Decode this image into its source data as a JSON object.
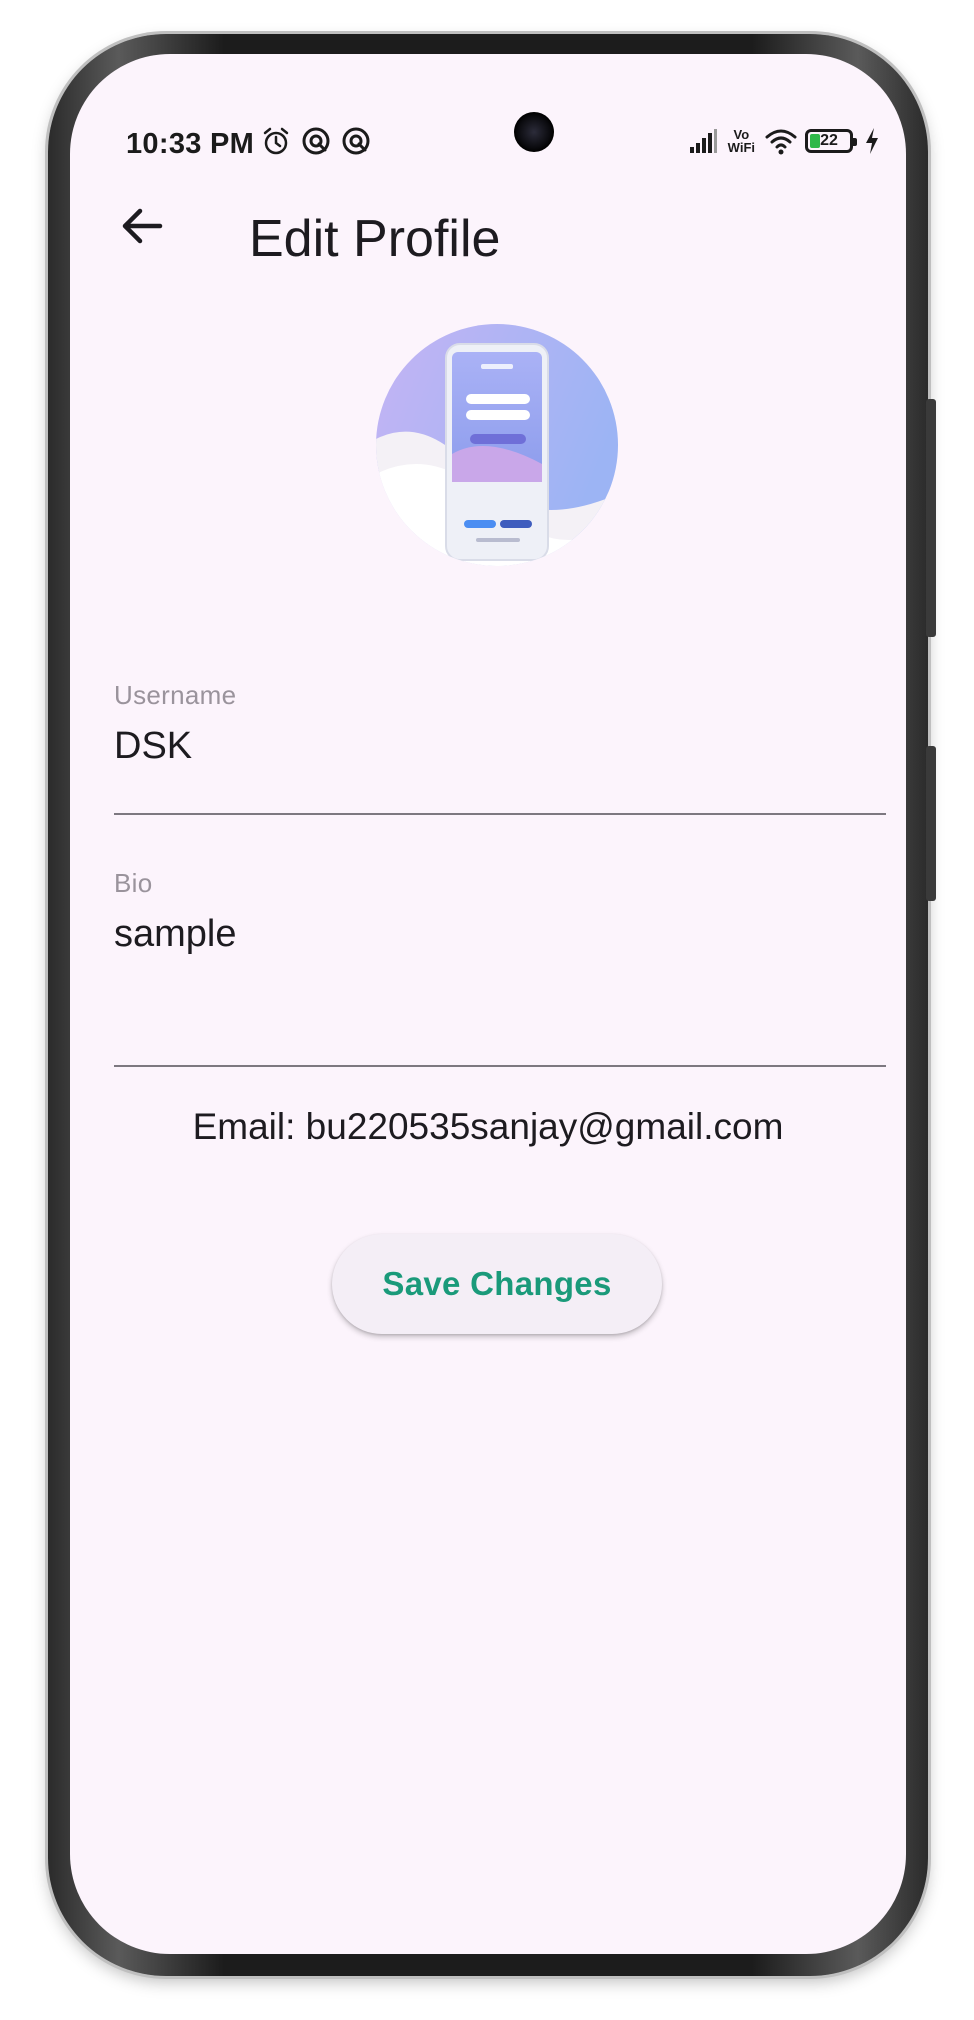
{
  "status_bar": {
    "time": "10:33 PM",
    "vowifi_top": "Vo",
    "vowifi_bottom": "WiFi",
    "battery_level": "22",
    "left_icons": [
      "alarm-icon",
      "app-notification-icon",
      "app-notification-icon"
    ],
    "right_icons": [
      "signal-icon",
      "vowifi-icon",
      "wifi-icon",
      "battery-icon",
      "charging-icon"
    ]
  },
  "app_bar": {
    "back_icon": "arrow-left-icon",
    "title": "Edit Profile"
  },
  "profile": {
    "avatar": "profile-image"
  },
  "form": {
    "username": {
      "label": "Username",
      "value": "DSK"
    },
    "bio": {
      "label": "Bio",
      "value": "sample"
    },
    "email_text": "Email: bu220535sanjay@gmail.com",
    "save_label": "Save Changes"
  },
  "colors": {
    "screen_background": "#fcf4fc",
    "accent_text": "#1a9a7a",
    "button_background": "#f4eef6"
  }
}
